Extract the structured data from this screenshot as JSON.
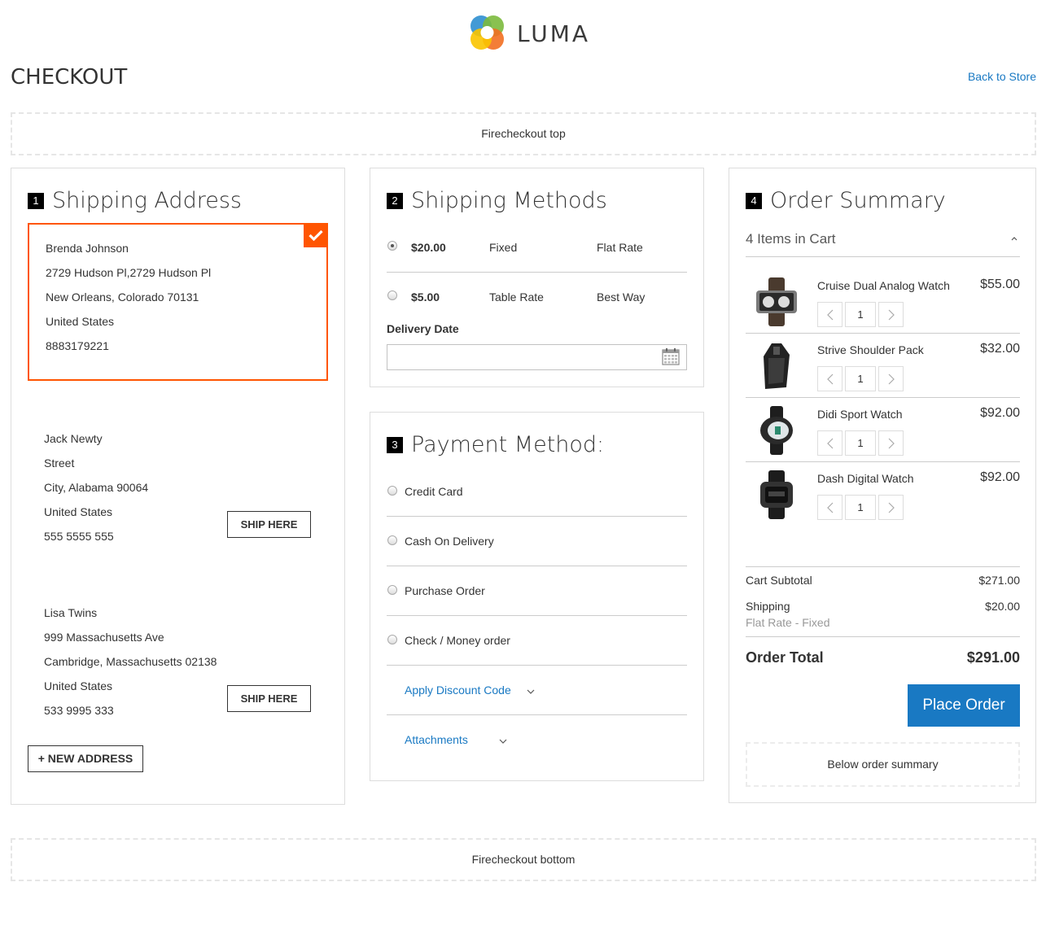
{
  "brand": {
    "name": "LUMA"
  },
  "header": {
    "title": "CHECKOUT",
    "back_link": "Back to Store"
  },
  "top_block": "Firecheckout top",
  "bottom_block": "Firecheckout bottom",
  "shipping_address": {
    "step": "1",
    "title": "Shipping Address",
    "addresses": [
      {
        "name": "Brenda Johnson",
        "street": "2729 Hudson Pl,2729 Hudson Pl",
        "city": "New Orleans, Colorado 70131",
        "country": "United States",
        "phone": "8883179221",
        "selected": true
      },
      {
        "name": "Jack Newty",
        "street": "Street",
        "city": "City, Alabama 90064",
        "country": "United States",
        "phone": "555 5555 555",
        "button": "SHIP HERE"
      },
      {
        "name": "Lisa Twins",
        "street": "999 Massachusetts Ave",
        "city": "Cambridge, Massachusetts 02138",
        "country": "United States",
        "phone": "533 9995 333",
        "button": "SHIP HERE"
      }
    ],
    "new_address_button": "+ NEW ADDRESS"
  },
  "shipping_methods": {
    "step": "2",
    "title": "Shipping Methods",
    "methods": [
      {
        "price": "$20.00",
        "method": "Fixed",
        "carrier": "Flat Rate",
        "selected": true
      },
      {
        "price": "$5.00",
        "method": "Table Rate",
        "carrier": "Best Way",
        "selected": false
      }
    ],
    "delivery_date_label": "Delivery Date",
    "delivery_date_value": ""
  },
  "payment": {
    "step": "3",
    "title": "Payment Method:",
    "methods": [
      "Credit Card",
      "Cash On Delivery",
      "Purchase Order",
      "Check / Money order"
    ],
    "discount_link": "Apply Discount Code",
    "attachments_link": "Attachments"
  },
  "order_summary": {
    "step": "4",
    "title": "Order Summary",
    "items_in_cart": "4 Items in Cart",
    "items": [
      {
        "name": "Cruise Dual Analog Watch",
        "price": "$55.00",
        "qty": "1",
        "icon": "watch-icon"
      },
      {
        "name": "Strive Shoulder Pack",
        "price": "$32.00",
        "qty": "1",
        "icon": "bag-icon"
      },
      {
        "name": "Didi Sport Watch",
        "price": "$92.00",
        "qty": "1",
        "icon": "watch-icon"
      },
      {
        "name": "Dash Digital Watch",
        "price": "$92.00",
        "qty": "1",
        "icon": "watch-icon"
      }
    ],
    "subtotal_label": "Cart Subtotal",
    "subtotal_value": "$271.00",
    "shipping_label": "Shipping",
    "shipping_value": "$20.00",
    "shipping_detail": "Flat Rate - Fixed",
    "total_label": "Order Total",
    "total_value": "$291.00",
    "place_order": "Place Order",
    "below_summary": "Below order summary"
  },
  "colors": {
    "accent": "#ff5501",
    "link": "#1979c3",
    "primary_button": "#1979c3"
  }
}
